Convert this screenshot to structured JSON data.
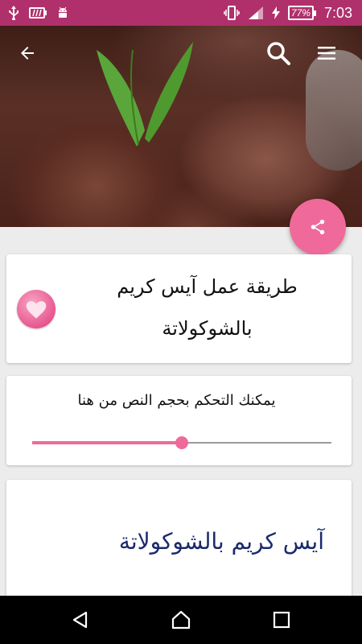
{
  "status_bar": {
    "time": "7:03",
    "battery_percent": "77%",
    "icons": [
      "usb-icon",
      "battery-alert-icon",
      "android-icon",
      "vibrate-icon",
      "signal-icon",
      "charging-icon"
    ]
  },
  "toolbar": {
    "back_icon": "arrow-back-icon",
    "search_icon": "search-icon",
    "menu_icon": "menu-icon"
  },
  "recipe": {
    "title": "طريقة عمل آيس كريم بالشوكولاتة",
    "heading": "آيس كريم بالشوكولاتة"
  },
  "text_size": {
    "label": "يمكنك التحكم بحجم النص من هنا",
    "value": 0.5
  },
  "colors": {
    "status_bar": "#b0306c",
    "accent": "#ef6a9a",
    "heading": "#1a2a6c"
  }
}
